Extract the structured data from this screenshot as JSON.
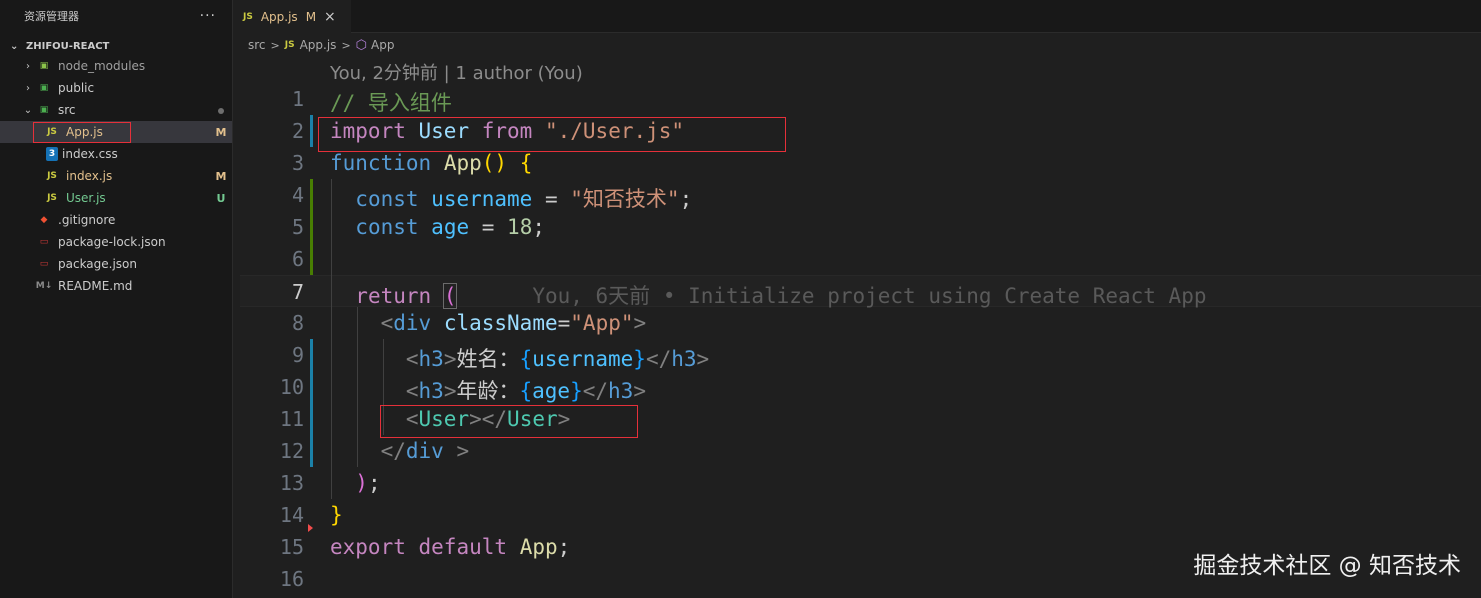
{
  "explorer": {
    "title": "资源管理器",
    "more": "···",
    "root": "ZHIFOU-REACT",
    "items": [
      {
        "name": "node_modules",
        "twistie": "›",
        "icon": "▣",
        "badge": ""
      },
      {
        "name": "public",
        "twistie": "›",
        "icon": "▣",
        "badge": ""
      },
      {
        "name": "src",
        "twistie": "⌄",
        "icon": "▣",
        "badge": ""
      },
      {
        "name": "App.js",
        "twistie": "",
        "icon": "JS",
        "badge": "M"
      },
      {
        "name": "index.css",
        "twistie": "",
        "icon": "3",
        "badge": ""
      },
      {
        "name": "index.js",
        "twistie": "",
        "icon": "JS",
        "badge": "M"
      },
      {
        "name": "User.js",
        "twistie": "",
        "icon": "JS",
        "badge": "U"
      },
      {
        "name": ".gitignore",
        "twistie": "",
        "icon": "◆",
        "badge": ""
      },
      {
        "name": "package-lock.json",
        "twistie": "",
        "icon": "▭",
        "badge": ""
      },
      {
        "name": "package.json",
        "twistie": "",
        "icon": "▭",
        "badge": ""
      },
      {
        "name": "README.md",
        "twistie": "",
        "icon": "M↓",
        "badge": ""
      }
    ]
  },
  "tab": {
    "icon": "JS",
    "name": "App.js",
    "status": "M",
    "close": "×"
  },
  "breadcrumb": {
    "folder": "src",
    "sep": ">",
    "file_icon": "JS",
    "file": "App.js",
    "symbol_icon": "⬡",
    "symbol": "App"
  },
  "codelens": "You, 2分钟前 | 1 author (You)",
  "line_numbers": [
    "1",
    "2",
    "3",
    "4",
    "5",
    "6",
    "7",
    "8",
    "9",
    "10",
    "11",
    "12",
    "13",
    "14",
    "15",
    "16"
  ],
  "code": {
    "l1": {
      "comment": "// 导入组件"
    },
    "l2": {
      "kw": "import",
      "sp1": " ",
      "id": "User",
      "sp2": " ",
      "from": "from",
      "sp3": " ",
      "str": "\"./User.js\""
    },
    "l3": {
      "kw": "function",
      "sp1": " ",
      "fn": "App",
      "paren": "()",
      "sp2": " ",
      "brace": "{"
    },
    "l4": {
      "indent": "  ",
      "kw": "const",
      "sp1": " ",
      "var": "username",
      "eq": " = ",
      "str": "\"知否技术\"",
      "semi": ";"
    },
    "l5": {
      "indent": "  ",
      "kw": "const",
      "sp1": " ",
      "var": "age",
      "eq": " = ",
      "num": "18",
      "semi": ";"
    },
    "l7": {
      "indent": "  ",
      "kw": "return",
      "sp1": " ",
      "paren": "(",
      "gap": "      ",
      "blame": "You, 6天前 • Initialize project using Create React App"
    },
    "l8": {
      "indent": "    ",
      "lt": "<",
      "tag": "div",
      "sp": " ",
      "attr": "className",
      "eq": "=",
      "str": "\"App\"",
      "gt": ">"
    },
    "l9": {
      "indent": "      ",
      "lt": "<",
      "tag": "h3",
      "gt": ">",
      "text": "姓名：",
      "ob": "{",
      "id": "username",
      "cb": "}",
      "lt2": "</",
      "tag2": "h3",
      "gt2": ">"
    },
    "l10": {
      "indent": "      ",
      "lt": "<",
      "tag": "h3",
      "gt": ">",
      "text": "年龄：",
      "ob": "{",
      "id": "age",
      "cb": "}",
      "lt2": "</",
      "tag2": "h3",
      "gt2": ">"
    },
    "l11": {
      "indent": "      ",
      "lt": "<",
      "comp": "User",
      "gt": ">",
      "lt2": "</",
      "comp2": "User",
      "gt2": ">"
    },
    "l12": {
      "indent": "    ",
      "lt": "</",
      "tag": "div",
      "gt": " >"
    },
    "l13": {
      "indent": "  ",
      "paren": ")",
      "semi": ";"
    },
    "l14": {
      "brace": "}"
    },
    "l15": {
      "kw": "export",
      "sp1": " ",
      "kw2": "default",
      "sp2": " ",
      "id": "App",
      "semi": ";"
    }
  },
  "watermark": "掘金技术社区 @ 知否技术",
  "colors": {
    "highlight_box": "#e5303a",
    "modified": "#e2c08d",
    "untracked": "#73c991"
  }
}
